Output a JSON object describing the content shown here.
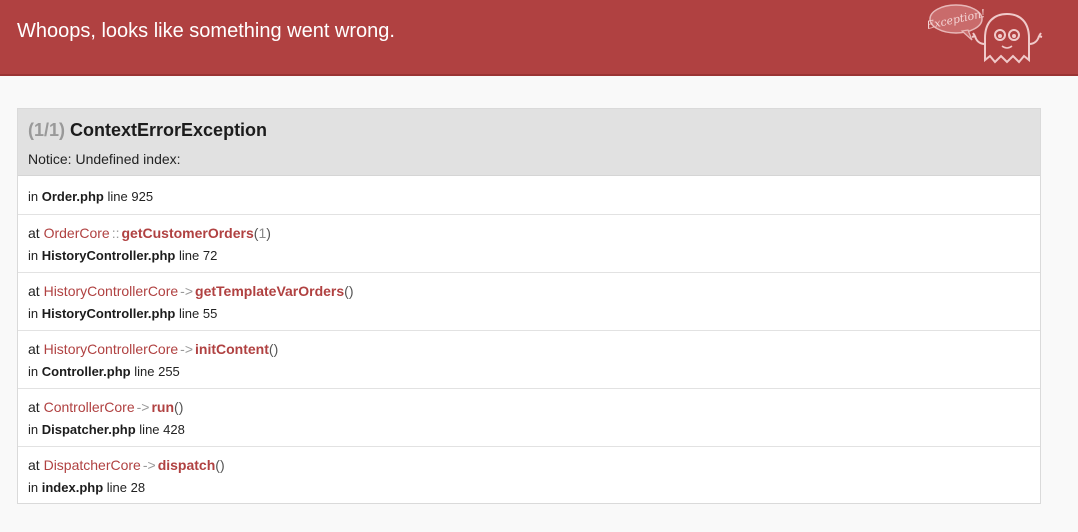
{
  "header": {
    "title": "Whoops, looks like something went wrong.",
    "mascot_label": "Exception!",
    "color": "#b04141"
  },
  "exception": {
    "count": "(1/1)",
    "name": "ContextErrorException",
    "message": "Notice: Undefined index:",
    "origin": {
      "in_label": "in",
      "file": "Order.php",
      "line_label": "line",
      "line": "925"
    }
  },
  "trace": [
    {
      "at": "at",
      "class": "OrderCore",
      "sep": "::",
      "method": "getCustomerOrders",
      "open": "(",
      "args": "1",
      "close": ")",
      "in_label": "in",
      "file": "HistoryController.php",
      "line_label": "line",
      "line": "72"
    },
    {
      "at": "at",
      "class": "HistoryControllerCore",
      "sep": "->",
      "method": "getTemplateVarOrders",
      "open": "(",
      "args": "",
      "close": ")",
      "in_label": "in",
      "file": "HistoryController.php",
      "line_label": "line",
      "line": "55"
    },
    {
      "at": "at",
      "class": "HistoryControllerCore",
      "sep": "->",
      "method": "initContent",
      "open": "(",
      "args": "",
      "close": ")",
      "in_label": "in",
      "file": "Controller.php",
      "line_label": "line",
      "line": "255"
    },
    {
      "at": "at",
      "class": "ControllerCore",
      "sep": "->",
      "method": "run",
      "open": "(",
      "args": "",
      "close": ")",
      "in_label": "in",
      "file": "Dispatcher.php",
      "line_label": "line",
      "line": "428"
    },
    {
      "at": "at",
      "class": "DispatcherCore",
      "sep": "->",
      "method": "dispatch",
      "open": "(",
      "args": "",
      "close": ")",
      "in_label": "in",
      "file": "index.php",
      "line_label": "line",
      "line": "28"
    }
  ]
}
